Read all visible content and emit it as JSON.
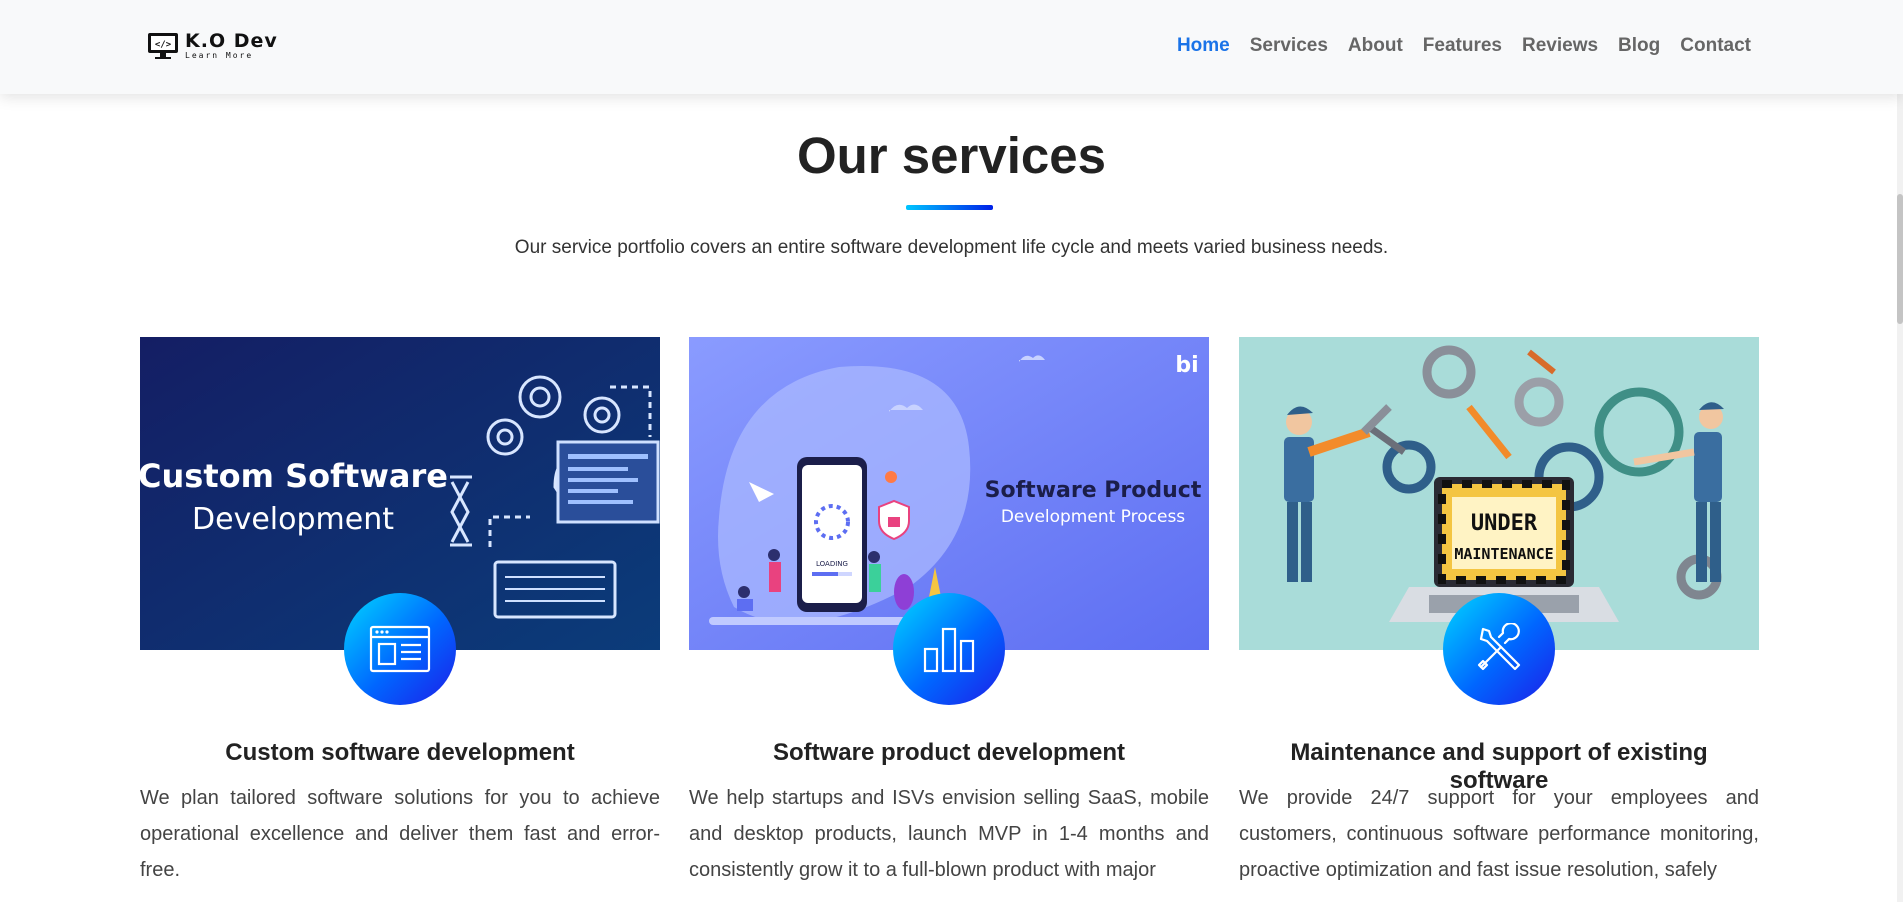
{
  "brand": {
    "name": "K.O Dev",
    "tagline": "Learn More"
  },
  "nav": {
    "items": [
      {
        "label": "Home",
        "active": true
      },
      {
        "label": "Services",
        "active": false
      },
      {
        "label": "About",
        "active": false
      },
      {
        "label": "Features",
        "active": false
      },
      {
        "label": "Reviews",
        "active": false
      },
      {
        "label": "Blog",
        "active": false
      },
      {
        "label": "Contact",
        "active": false
      }
    ]
  },
  "section": {
    "title": "Our services",
    "subtitle": "Our service portfolio covers an entire software development life cycle and meets varied business needs."
  },
  "cards": [
    {
      "image_line1": "Custom Software",
      "image_line2": "Development",
      "icon": "browser-window-icon",
      "title": "Custom software development",
      "text": "We plan tailored software solutions for you to achieve operational excellence and deliver them fast and error-free."
    },
    {
      "image_line1": "Software Product",
      "image_line2": "Development Process",
      "image_loading": "LOADING",
      "image_logo": "bi",
      "icon": "bar-chart-icon",
      "title": "Software product development",
      "text": "We help startups and ISVs envision selling SaaS, mobile and desktop products, launch MVP in 1-4 months and consistently grow it to a full-blown product with major"
    },
    {
      "image_line1": "UNDER",
      "image_line2": "MAINTENANCE",
      "icon": "tools-icon",
      "title": "Maintenance and support of existing software",
      "text": "We provide 24/7 support for your employees and customers, continuous software performance monitoring, proactive optimization and fast issue resolution, safely"
    }
  ],
  "colors": {
    "accent": "#1a73e8",
    "nav_text": "#666666",
    "icon_gradient_start": "#00d7ff",
    "icon_gradient_end": "#1e1ee8",
    "card1_bg": "#0e1e63",
    "card2_bg": "#7b8cff",
    "card3_bg": "#a8dcd9"
  }
}
